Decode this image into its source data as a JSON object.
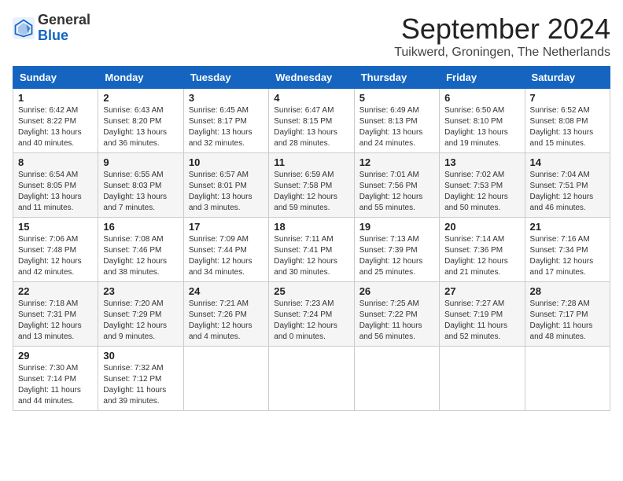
{
  "logo": {
    "general": "General",
    "blue": "Blue"
  },
  "title": "September 2024",
  "location": "Tuikwerd, Groningen, The Netherlands",
  "headers": [
    "Sunday",
    "Monday",
    "Tuesday",
    "Wednesday",
    "Thursday",
    "Friday",
    "Saturday"
  ],
  "weeks": [
    [
      {
        "day": "1",
        "sunrise": "Sunrise: 6:42 AM",
        "sunset": "Sunset: 8:22 PM",
        "daylight": "Daylight: 13 hours and 40 minutes."
      },
      {
        "day": "2",
        "sunrise": "Sunrise: 6:43 AM",
        "sunset": "Sunset: 8:20 PM",
        "daylight": "Daylight: 13 hours and 36 minutes."
      },
      {
        "day": "3",
        "sunrise": "Sunrise: 6:45 AM",
        "sunset": "Sunset: 8:17 PM",
        "daylight": "Daylight: 13 hours and 32 minutes."
      },
      {
        "day": "4",
        "sunrise": "Sunrise: 6:47 AM",
        "sunset": "Sunset: 8:15 PM",
        "daylight": "Daylight: 13 hours and 28 minutes."
      },
      {
        "day": "5",
        "sunrise": "Sunrise: 6:49 AM",
        "sunset": "Sunset: 8:13 PM",
        "daylight": "Daylight: 13 hours and 24 minutes."
      },
      {
        "day": "6",
        "sunrise": "Sunrise: 6:50 AM",
        "sunset": "Sunset: 8:10 PM",
        "daylight": "Daylight: 13 hours and 19 minutes."
      },
      {
        "day": "7",
        "sunrise": "Sunrise: 6:52 AM",
        "sunset": "Sunset: 8:08 PM",
        "daylight": "Daylight: 13 hours and 15 minutes."
      }
    ],
    [
      {
        "day": "8",
        "sunrise": "Sunrise: 6:54 AM",
        "sunset": "Sunset: 8:05 PM",
        "daylight": "Daylight: 13 hours and 11 minutes."
      },
      {
        "day": "9",
        "sunrise": "Sunrise: 6:55 AM",
        "sunset": "Sunset: 8:03 PM",
        "daylight": "Daylight: 13 hours and 7 minutes."
      },
      {
        "day": "10",
        "sunrise": "Sunrise: 6:57 AM",
        "sunset": "Sunset: 8:01 PM",
        "daylight": "Daylight: 13 hours and 3 minutes."
      },
      {
        "day": "11",
        "sunrise": "Sunrise: 6:59 AM",
        "sunset": "Sunset: 7:58 PM",
        "daylight": "Daylight: 12 hours and 59 minutes."
      },
      {
        "day": "12",
        "sunrise": "Sunrise: 7:01 AM",
        "sunset": "Sunset: 7:56 PM",
        "daylight": "Daylight: 12 hours and 55 minutes."
      },
      {
        "day": "13",
        "sunrise": "Sunrise: 7:02 AM",
        "sunset": "Sunset: 7:53 PM",
        "daylight": "Daylight: 12 hours and 50 minutes."
      },
      {
        "day": "14",
        "sunrise": "Sunrise: 7:04 AM",
        "sunset": "Sunset: 7:51 PM",
        "daylight": "Daylight: 12 hours and 46 minutes."
      }
    ],
    [
      {
        "day": "15",
        "sunrise": "Sunrise: 7:06 AM",
        "sunset": "Sunset: 7:48 PM",
        "daylight": "Daylight: 12 hours and 42 minutes."
      },
      {
        "day": "16",
        "sunrise": "Sunrise: 7:08 AM",
        "sunset": "Sunset: 7:46 PM",
        "daylight": "Daylight: 12 hours and 38 minutes."
      },
      {
        "day": "17",
        "sunrise": "Sunrise: 7:09 AM",
        "sunset": "Sunset: 7:44 PM",
        "daylight": "Daylight: 12 hours and 34 minutes."
      },
      {
        "day": "18",
        "sunrise": "Sunrise: 7:11 AM",
        "sunset": "Sunset: 7:41 PM",
        "daylight": "Daylight: 12 hours and 30 minutes."
      },
      {
        "day": "19",
        "sunrise": "Sunrise: 7:13 AM",
        "sunset": "Sunset: 7:39 PM",
        "daylight": "Daylight: 12 hours and 25 minutes."
      },
      {
        "day": "20",
        "sunrise": "Sunrise: 7:14 AM",
        "sunset": "Sunset: 7:36 PM",
        "daylight": "Daylight: 12 hours and 21 minutes."
      },
      {
        "day": "21",
        "sunrise": "Sunrise: 7:16 AM",
        "sunset": "Sunset: 7:34 PM",
        "daylight": "Daylight: 12 hours and 17 minutes."
      }
    ],
    [
      {
        "day": "22",
        "sunrise": "Sunrise: 7:18 AM",
        "sunset": "Sunset: 7:31 PM",
        "daylight": "Daylight: 12 hours and 13 minutes."
      },
      {
        "day": "23",
        "sunrise": "Sunrise: 7:20 AM",
        "sunset": "Sunset: 7:29 PM",
        "daylight": "Daylight: 12 hours and 9 minutes."
      },
      {
        "day": "24",
        "sunrise": "Sunrise: 7:21 AM",
        "sunset": "Sunset: 7:26 PM",
        "daylight": "Daylight: 12 hours and 4 minutes."
      },
      {
        "day": "25",
        "sunrise": "Sunrise: 7:23 AM",
        "sunset": "Sunset: 7:24 PM",
        "daylight": "Daylight: 12 hours and 0 minutes."
      },
      {
        "day": "26",
        "sunrise": "Sunrise: 7:25 AM",
        "sunset": "Sunset: 7:22 PM",
        "daylight": "Daylight: 11 hours and 56 minutes."
      },
      {
        "day": "27",
        "sunrise": "Sunrise: 7:27 AM",
        "sunset": "Sunset: 7:19 PM",
        "daylight": "Daylight: 11 hours and 52 minutes."
      },
      {
        "day": "28",
        "sunrise": "Sunrise: 7:28 AM",
        "sunset": "Sunset: 7:17 PM",
        "daylight": "Daylight: 11 hours and 48 minutes."
      }
    ],
    [
      {
        "day": "29",
        "sunrise": "Sunrise: 7:30 AM",
        "sunset": "Sunset: 7:14 PM",
        "daylight": "Daylight: 11 hours and 44 minutes."
      },
      {
        "day": "30",
        "sunrise": "Sunrise: 7:32 AM",
        "sunset": "Sunset: 7:12 PM",
        "daylight": "Daylight: 11 hours and 39 minutes."
      },
      null,
      null,
      null,
      null,
      null
    ]
  ]
}
